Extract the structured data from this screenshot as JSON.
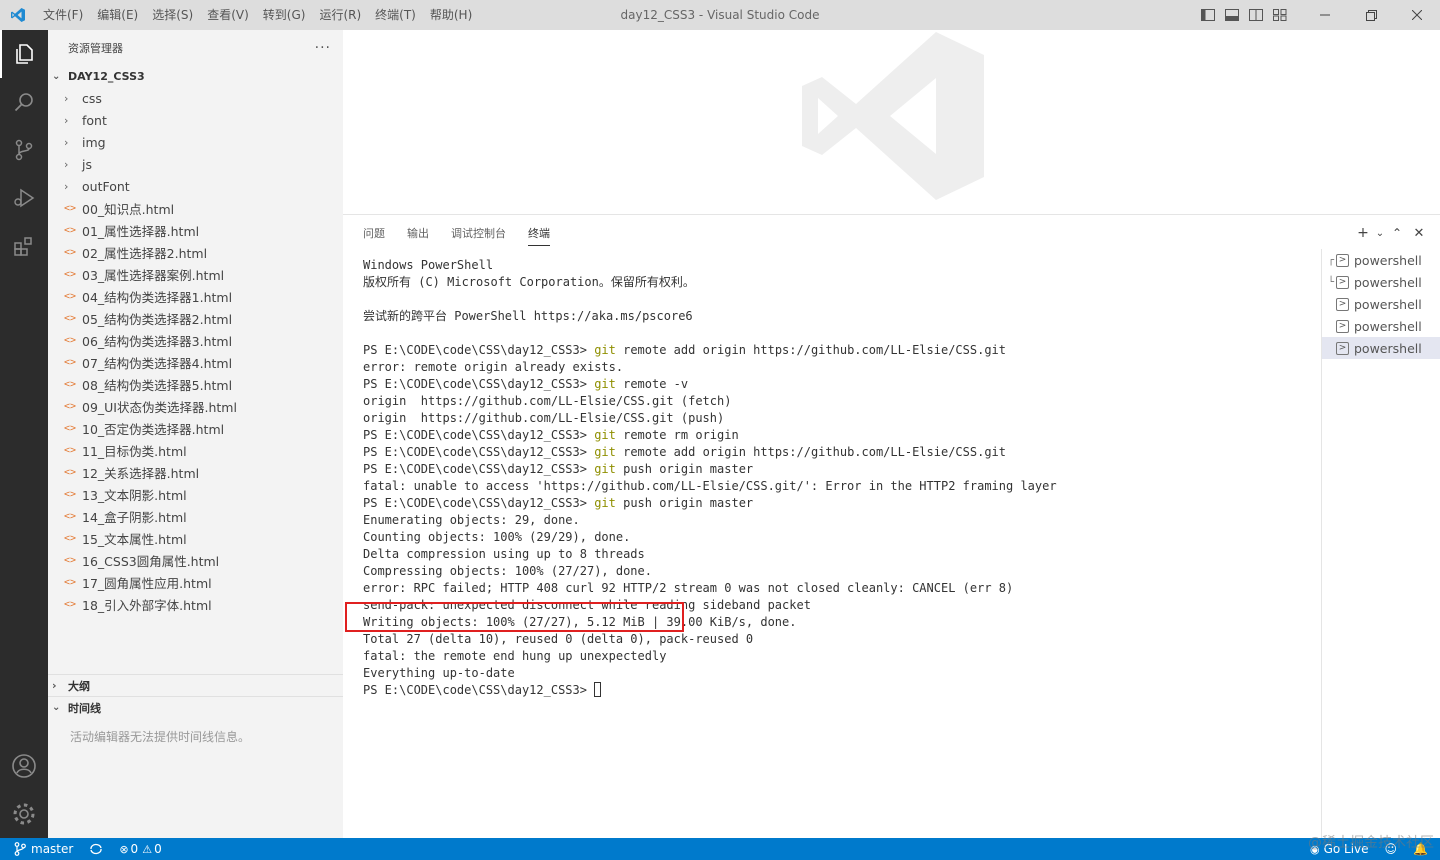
{
  "titlebar": {
    "menu": [
      "文件(F)",
      "编辑(E)",
      "选择(S)",
      "查看(V)",
      "转到(G)",
      "运行(R)",
      "终端(T)",
      "帮助(H)"
    ],
    "title": "day12_CSS3 - Visual Studio Code"
  },
  "sidebar": {
    "header": "资源管理器",
    "more": "···",
    "root": "DAY12_CSS3",
    "folders": [
      "css",
      "font",
      "img",
      "js",
      "outFont"
    ],
    "files": [
      "00_知识点.html",
      "01_属性选择器.html",
      "02_属性选择器2.html",
      "03_属性选择器案例.html",
      "04_结构伪类选择器1.html",
      "05_结构伪类选择器2.html",
      "06_结构伪类选择器3.html",
      "07_结构伪类选择器4.html",
      "08_结构伪类选择器5.html",
      "09_UI状态伪类选择器.html",
      "10_否定伪类选择器.html",
      "11_目标伪类.html",
      "12_关系选择器.html",
      "13_文本阴影.html",
      "14_盒子阴影.html",
      "15_文本属性.html",
      "16_CSS3圆角属性.html",
      "17_圆角属性应用.html",
      "18_引入外部字体.html"
    ],
    "outline": "大纲",
    "timeline": "时间线",
    "timeline_msg": "活动编辑器无法提供时间线信息。"
  },
  "panel": {
    "tabs": [
      "问题",
      "输出",
      "调试控制台",
      "终端"
    ],
    "active_tab": "终端",
    "terminals": [
      "powershell",
      "powershell",
      "powershell",
      "powershell",
      "powershell"
    ],
    "terminal_lines": [
      {
        "text": "Windows PowerShell"
      },
      {
        "text": "版权所有 (C) Microsoft Corporation。保留所有权利。"
      },
      {
        "text": ""
      },
      {
        "text": "尝试新的跨平台 PowerShell https://aka.ms/pscore6"
      },
      {
        "text": ""
      },
      {
        "prompt": "PS E:\\CODE\\code\\CSS\\day12_CSS3> ",
        "cmd": "git",
        "args": " remote add origin https://github.com/LL-Elsie/CSS.git"
      },
      {
        "text": "error: remote origin already exists."
      },
      {
        "prompt": "PS E:\\CODE\\code\\CSS\\day12_CSS3> ",
        "cmd": "git",
        "args": " remote -v"
      },
      {
        "text": "origin  https://github.com/LL-Elsie/CSS.git (fetch)"
      },
      {
        "text": "origin  https://github.com/LL-Elsie/CSS.git (push)"
      },
      {
        "prompt": "PS E:\\CODE\\code\\CSS\\day12_CSS3> ",
        "cmd": "git",
        "args": " remote rm origin"
      },
      {
        "prompt": "PS E:\\CODE\\code\\CSS\\day12_CSS3> ",
        "cmd": "git",
        "args": " remote add origin https://github.com/LL-Elsie/CSS.git"
      },
      {
        "prompt": "PS E:\\CODE\\code\\CSS\\day12_CSS3> ",
        "cmd": "git",
        "args": " push origin master"
      },
      {
        "text": "fatal: unable to access 'https://github.com/LL-Elsie/CSS.git/': Error in the HTTP2 framing layer"
      },
      {
        "prompt": "PS E:\\CODE\\code\\CSS\\day12_CSS3> ",
        "cmd": "git",
        "args": " push origin master"
      },
      {
        "text": "Enumerating objects: 29, done."
      },
      {
        "text": "Counting objects: 100% (29/29), done."
      },
      {
        "text": "Delta compression using up to 8 threads"
      },
      {
        "text": "Compressing objects: 100% (27/27), done."
      },
      {
        "text": "error: RPC failed; HTTP 408 curl 92 HTTP/2 stream 0 was not closed cleanly: CANCEL (err 8)"
      },
      {
        "text": "send-pack: unexpected disconnect while reading sideband packet"
      },
      {
        "text": "Writing objects: 100% (27/27), 5.12 MiB | 39.00 KiB/s, done."
      },
      {
        "text": "Total 27 (delta 10), reused 0 (delta 0), pack-reused 0"
      },
      {
        "text": "fatal: the remote end hung up unexpectedly"
      },
      {
        "text": "Everything up-to-date"
      },
      {
        "prompt": "PS E:\\CODE\\code\\CSS\\day12_CSS3> ",
        "cursor": true
      }
    ]
  },
  "statusbar": {
    "branch": "master",
    "errors": "0",
    "warnings": "0",
    "golive": "Go Live"
  },
  "watermark": "@稀土掘金技术社区",
  "colors": {
    "accent": "#007acc",
    "git_cmd": "#8f8f00",
    "highlight_box": "#e02020",
    "html_icon": "#e37933"
  }
}
